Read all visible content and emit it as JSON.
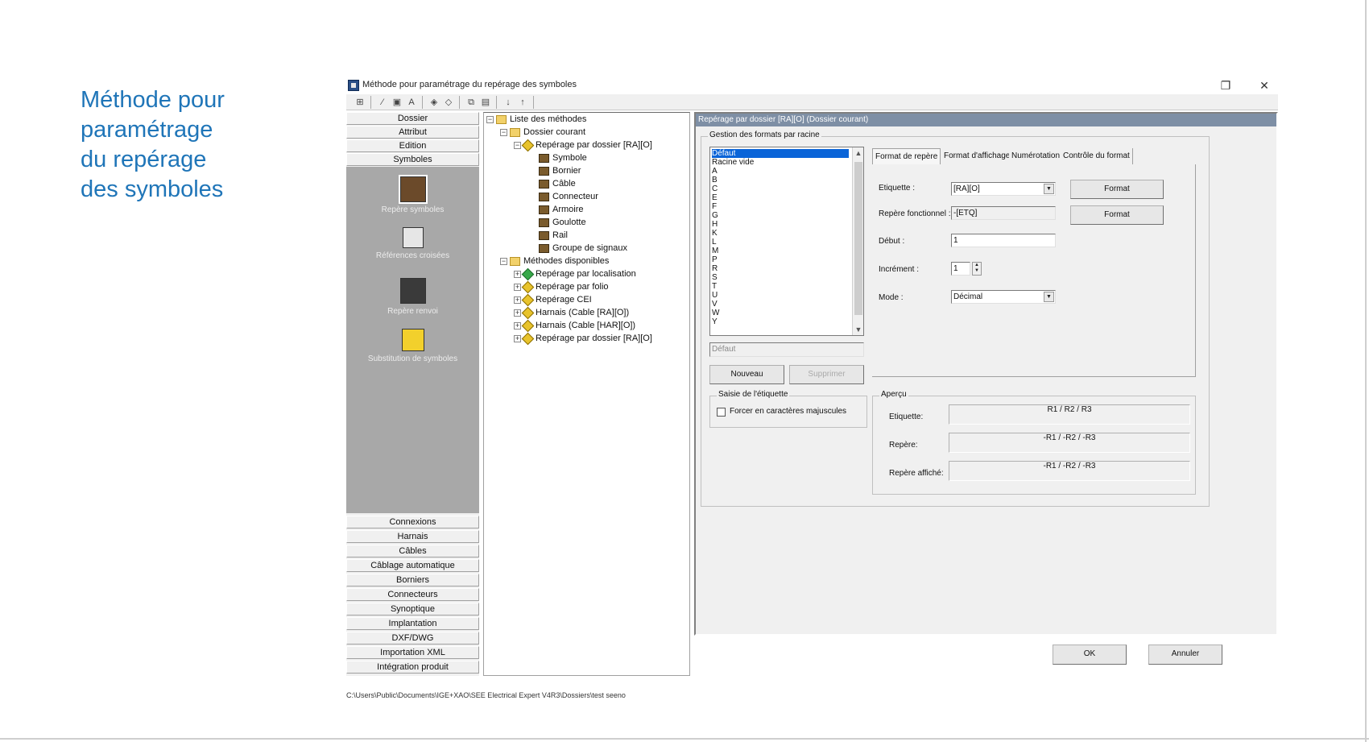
{
  "slide": {
    "title": "Méthode pour\nparamétrage\ndu repérage\ndes symboles"
  },
  "window": {
    "title": "Méthode pour paramétrage du repérage des symboles",
    "restore_glyph": "❐",
    "close_glyph": "✕"
  },
  "toolbar": {
    "arrow_down": "↓",
    "arrow_up": "↑"
  },
  "nav": {
    "top_buttons": [
      "Dossier",
      "Attribut",
      "Edition",
      "Symboles"
    ],
    "panel_items": [
      "Repère symboles",
      "Références croisées",
      "Repère renvoi",
      "Substitution de symboles"
    ],
    "bottom_buttons": [
      "Connexions",
      "Harnais",
      "Câbles",
      "Câblage automatique",
      "Borniers",
      "Connecteurs",
      "Synoptique",
      "Implantation",
      "DXF/DWG",
      "Importation XML",
      "Intégration produit"
    ]
  },
  "tree": {
    "root": "Liste des méthodes",
    "current_folder": "Dossier courant",
    "current_method": "Repérage par dossier [RA][O]",
    "children": [
      "Symbole",
      "Bornier",
      "Câble",
      "Connecteur",
      "Armoire",
      "Goulotte",
      "Rail",
      "Groupe de signaux"
    ],
    "available_folder": "Méthodes disponibles",
    "available": [
      "Repérage par localisation",
      "Repérage par folio",
      "Repérage CEI",
      "Harnais (Cable [RA][O])",
      "Harnais (Cable [HAR][O])",
      "Repérage par dossier [RA][O]"
    ]
  },
  "main": {
    "header": "Repérage par dossier [RA][O] (Dossier courant)",
    "roots_group": "Gestion des formats par racine",
    "roots": [
      "Défaut",
      "Racine vide",
      "A",
      "B",
      "C",
      "E",
      "F",
      "G",
      "H",
      "K",
      "L",
      "M",
      "P",
      "R",
      "S",
      "T",
      "U",
      "V",
      "W",
      "Y"
    ],
    "root_input": "Défaut",
    "new_button": "Nouveau",
    "delete_button": "Supprimer",
    "label_group": "Saisie de l'étiquette",
    "force_upper": "Forcer en caractères majuscules",
    "tabs": [
      "Format de repère",
      "Format d'affichage",
      "Numérotation",
      "Contrôle du format"
    ],
    "etiquette_label": "Etiquette :",
    "etiquette_value": "[RA][O]",
    "format_button": "Format",
    "repere_fonct_label": "Repère fonctionnel :",
    "repere_fonct_value": "-[ETQ]",
    "debut_label": "Début :",
    "debut_value": "1",
    "increment_label": "Incrément :",
    "increment_value": "1",
    "mode_label": "Mode :",
    "mode_value": "Décimal",
    "apercu_group": "Aperçu",
    "apercu_etiquette_label": "Etiquette:",
    "apercu_etiquette_value": "R1 / R2 / R3",
    "apercu_repere_label": "Repère:",
    "apercu_repere_value": "-R1 / -R2 / -R3",
    "apercu_affiche_label": "Repère affiché:",
    "apercu_affiche_value": "-R1 / -R2 / -R3"
  },
  "dialog": {
    "ok": "OK",
    "cancel": "Annuler"
  },
  "status": {
    "path": "C:\\Users\\Public\\Documents\\IGE+XAO\\SEE Electrical Expert V4R3\\Dossiers\\test seeno"
  }
}
